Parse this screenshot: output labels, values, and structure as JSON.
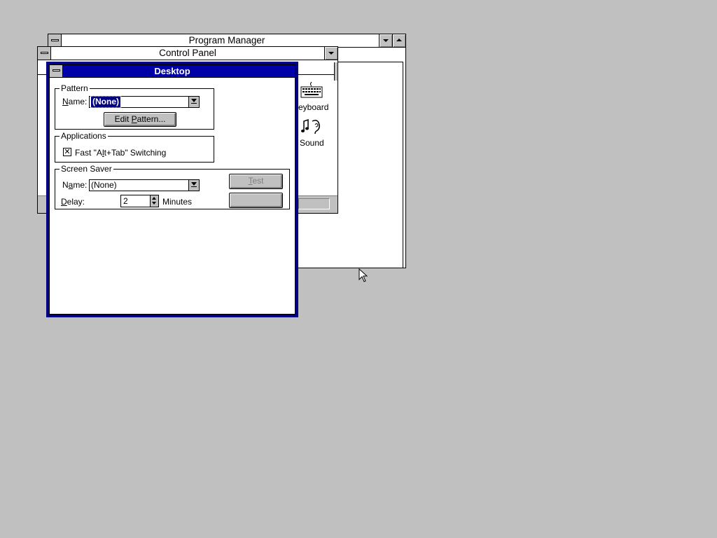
{
  "program_manager": {
    "title": "Program Manager"
  },
  "control_panel": {
    "title": "Control Panel",
    "icons": [
      {
        "label": "eyboard",
        "icon": "keyboard-icon"
      },
      {
        "label": "Sound",
        "icon": "sound-icon"
      }
    ]
  },
  "desktop_dialog": {
    "title": "Desktop",
    "pattern": {
      "group_label": "Pattern",
      "name_label": "Name:",
      "name_value": "(None)",
      "edit_button": "Edit Pattern..."
    },
    "applications": {
      "group_label": "Applications",
      "fast_switch_label": "Fast \"Alt+Tab\" Switching",
      "fast_switch_checked": true
    },
    "screen_saver": {
      "group_label": "Screen Saver",
      "name_label": "Name:",
      "name_value": "(None)",
      "delay_label": "Delay:",
      "delay_value": "2",
      "delay_units": "Minutes",
      "test_button": "Test",
      "setup_button": ""
    }
  },
  "colors": {
    "desktop": "#c0c0c0",
    "active_title": "#0000a8",
    "active_border": "#000080",
    "selection": "#000080"
  }
}
